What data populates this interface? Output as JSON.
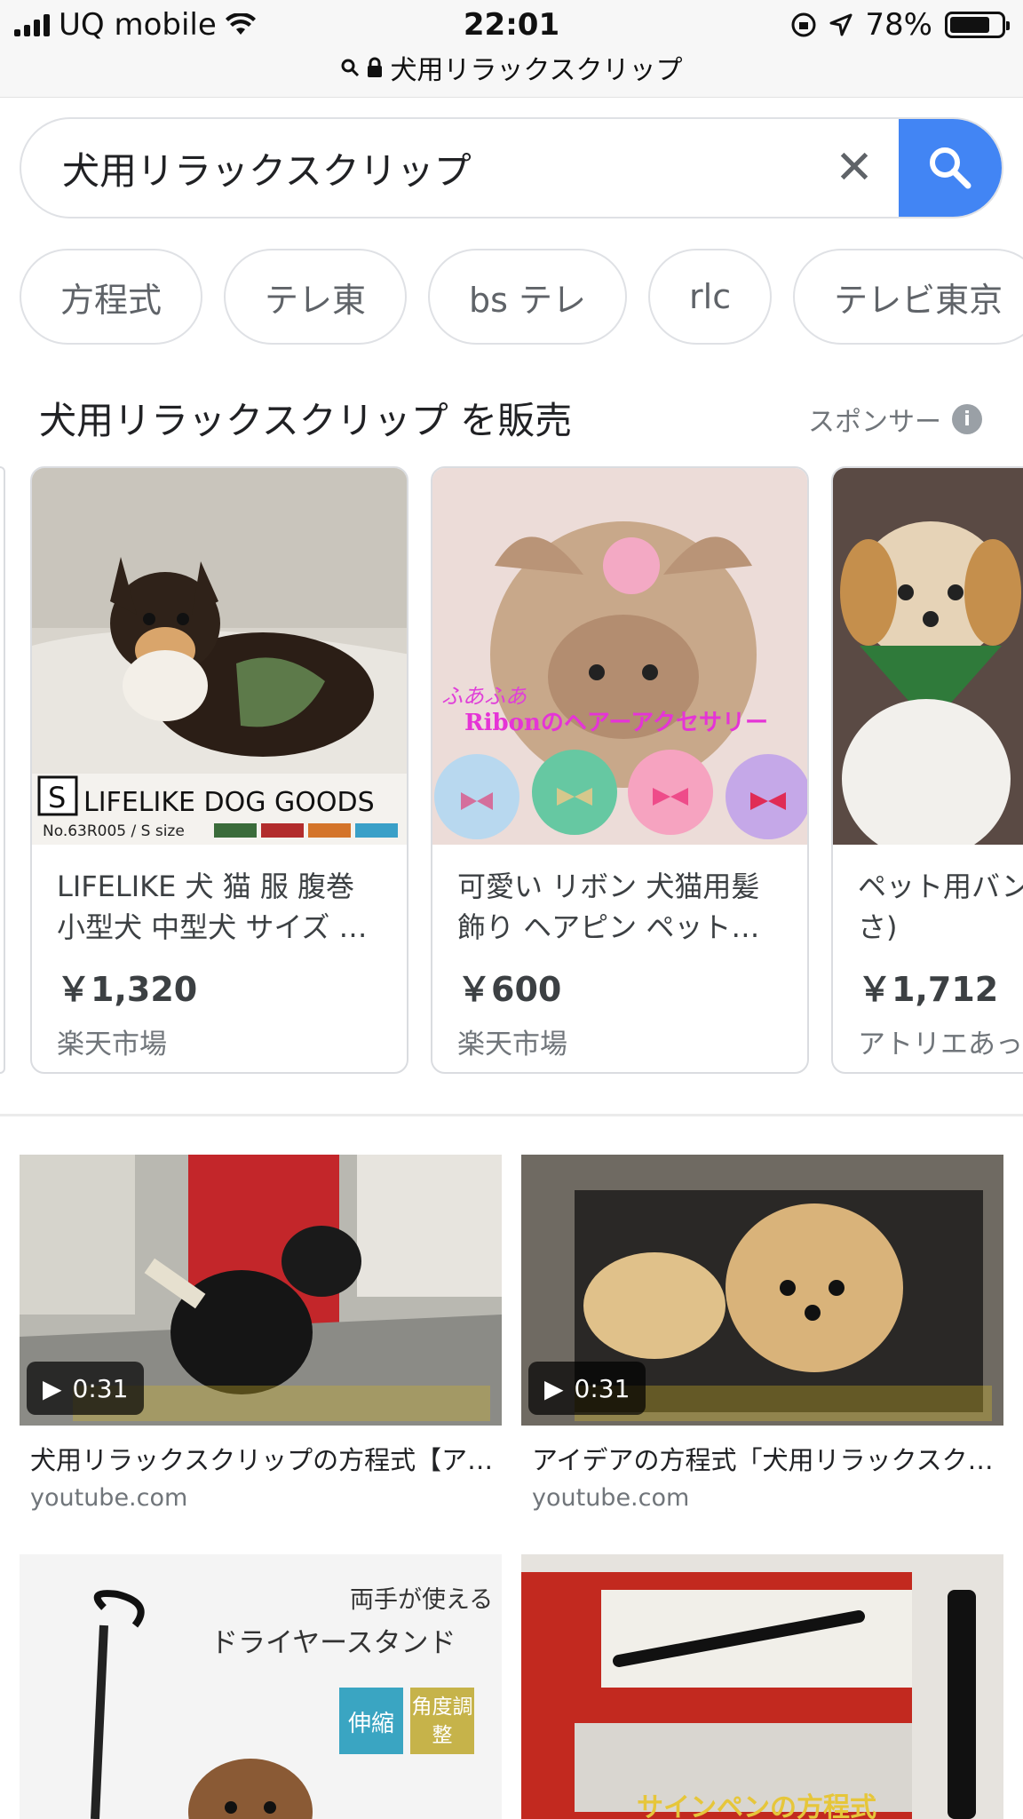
{
  "status_bar": {
    "carrier": "UQ mobile",
    "time": "22:01",
    "battery": "78%",
    "battery_level": 0.78
  },
  "url_bar": {
    "text": "犬用リラックスクリップ"
  },
  "search": {
    "query": "犬用リラックスクリップ"
  },
  "chips": [
    "方程式",
    "テレ東",
    "bs テレ",
    "rlc",
    "テレビ東京"
  ],
  "shopping": {
    "heading": "犬用リラックスクリップ を販売",
    "sponsored_label": "スポンサー",
    "products": [
      {
        "title": "LIFELIKE 犬 猫 服 腹巻 小型犬 中型犬 サイズ …",
        "price": "￥1,320",
        "store": "楽天市場",
        "image_text": "LIFELIKE DOG GOODS",
        "image_size_badge": "S",
        "image_sub": "No.63R005 / S size"
      },
      {
        "title": "可愛い リボン 犬猫用髪飾り ヘアピン ペット…",
        "price": "￥600",
        "store": "楽天市場",
        "image_text": "Ribonのヘアーアクセサリー",
        "image_sub": "ふあふあ"
      },
      {
        "title": "ペット用バン 草(からくさ)",
        "price": "￥1,712",
        "store": "アトリエあっ"
      }
    ]
  },
  "videos": [
    {
      "duration": "0:31",
      "title": "犬用リラックスクリップの方程式【ア…",
      "source": "youtube.com"
    },
    {
      "duration": "0:31",
      "title": "アイデアの方程式「犬用リラックスク…",
      "source": "youtube.com"
    }
  ],
  "image_results": [
    {
      "caption_line1": "両手が使える",
      "caption_line2": "ドライヤースタンド",
      "tag1": "伸縮",
      "tag2": "角度調整"
    },
    {
      "caption": "サインペンの方程式"
    }
  ]
}
